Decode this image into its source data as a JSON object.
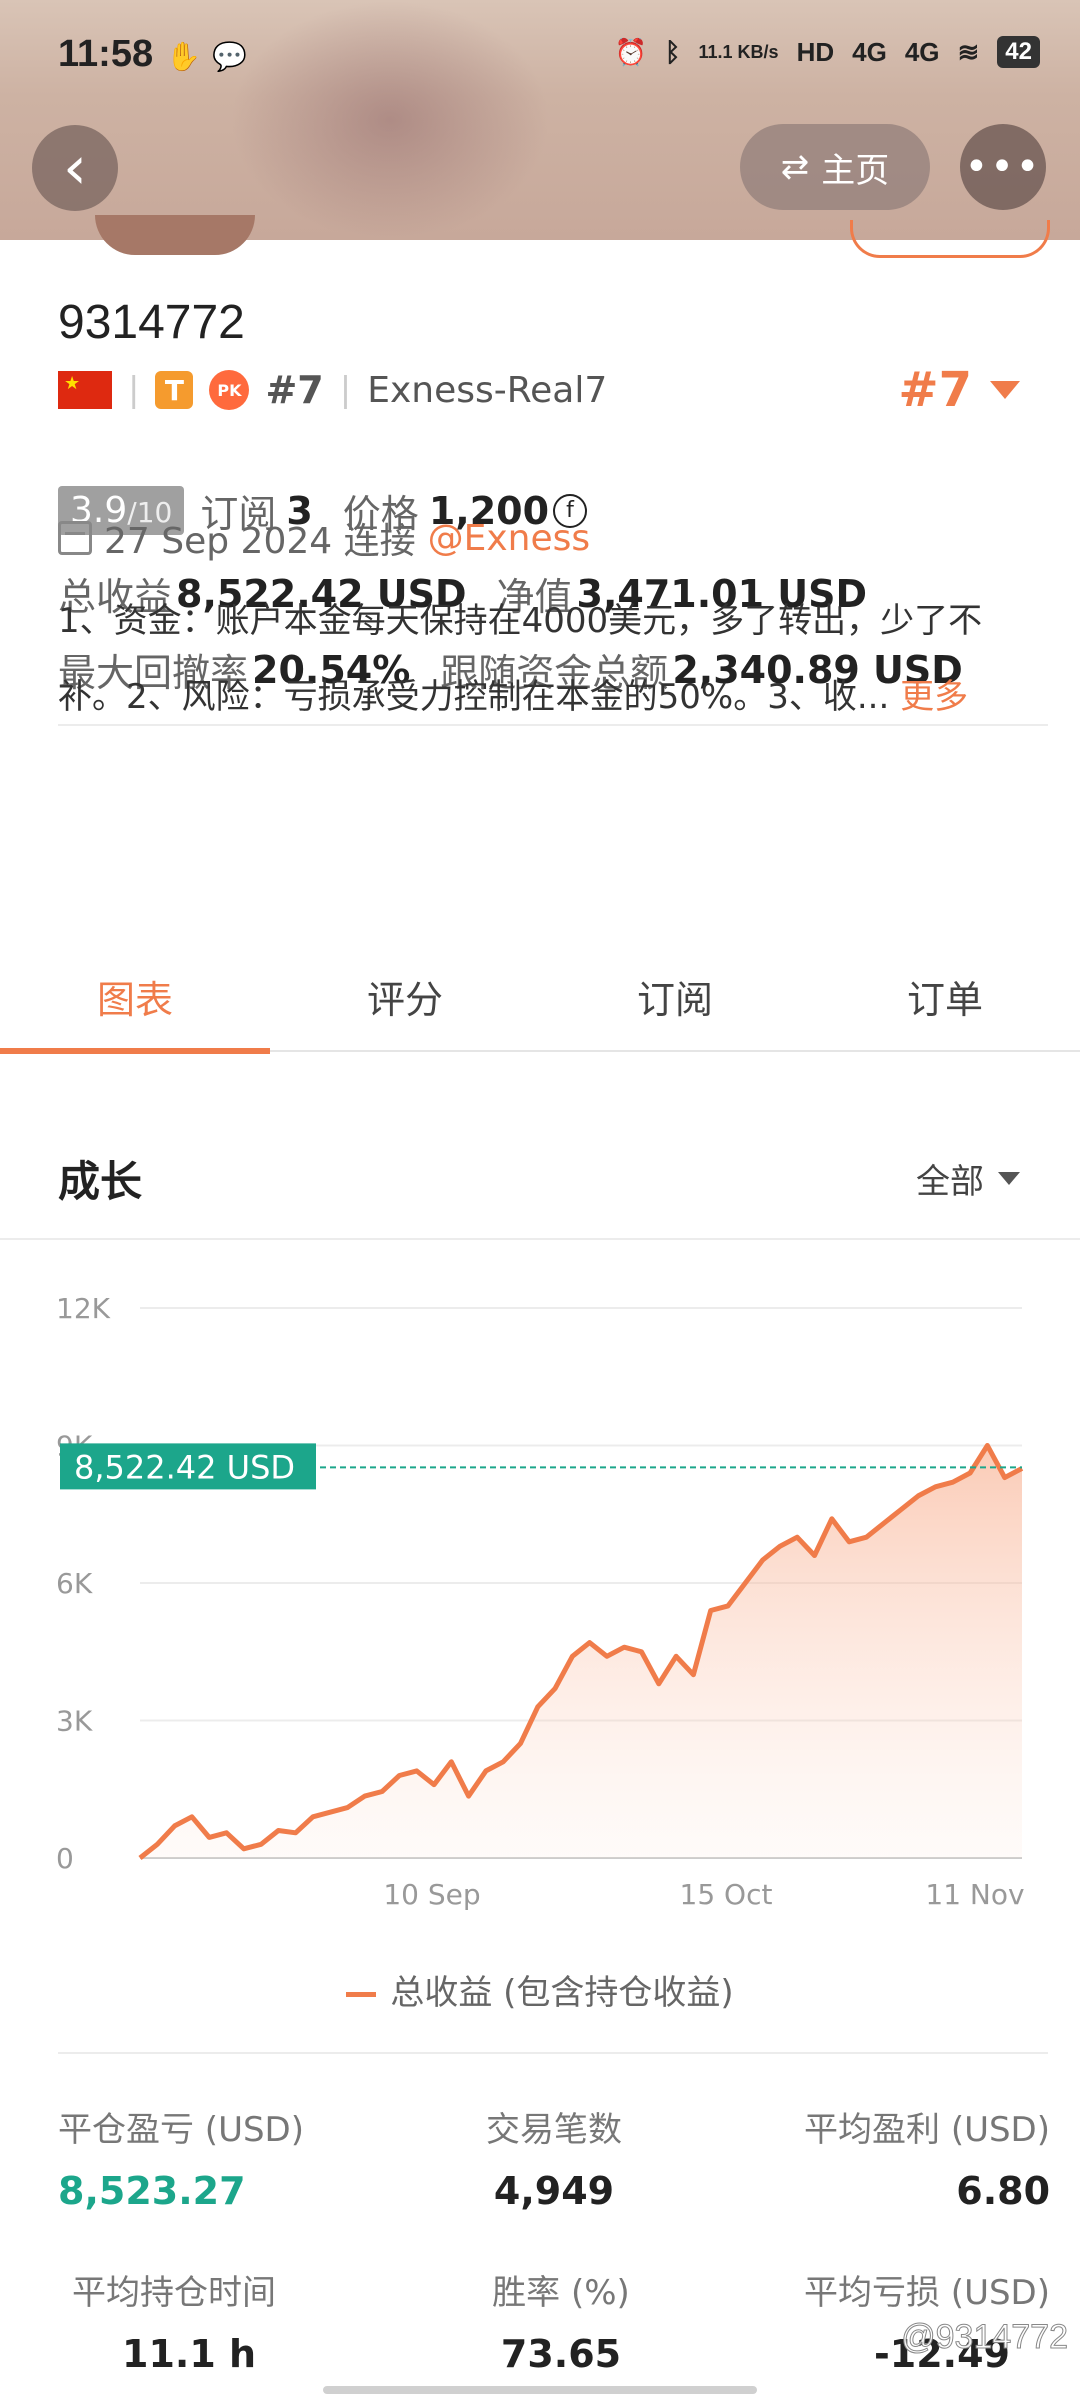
{
  "status_bar": {
    "time": "11:58",
    "network_speed": "11.1\nKB/s",
    "signal_1": "4G",
    "signal_2": "4G",
    "battery": "42"
  },
  "nav": {
    "home_label": "主页",
    "back_icon": "back-arrow-icon",
    "more_icon": "more-dots-icon"
  },
  "profile": {
    "account_id": "9314772",
    "rank_small": "#7",
    "server": "Exness-Real7",
    "rank_big": "#7",
    "t_badge": "T",
    "pk_badge": "PK"
  },
  "stats": {
    "score": "3.9",
    "score_max": "/10",
    "subscribe_label": "订阅",
    "subscribe_count": "3",
    "price_label": "价格",
    "price_value": "1,200",
    "price_symbol": "f",
    "total_profit_label": "总收益",
    "total_profit_value": "8,522.42 USD",
    "equity_label": "净值",
    "equity_value": "3,471.01 USD",
    "max_dd_label": "最大回撤率",
    "max_dd_value": "20.54%",
    "follow_funds_label": "跟随资金总额",
    "follow_funds_value": "2,340.89 USD"
  },
  "connection": {
    "date": "27 Sep 2024 连接",
    "broker": "@Exness"
  },
  "description": {
    "text": "1、资金：账户本金每天保持在4000美元，多了转出，少了不补。2、风险：亏损承受力控制在本金的50%。3、收...",
    "more": "更多"
  },
  "tabs": [
    {
      "label": "图表",
      "active": true
    },
    {
      "label": "评分",
      "active": false
    },
    {
      "label": "订阅",
      "active": false
    },
    {
      "label": "订单",
      "active": false
    }
  ],
  "section": {
    "title": "成长",
    "range": "全部"
  },
  "chart_data": {
    "type": "area",
    "y_ticks": [
      "12K",
      "9K",
      "6K",
      "3K",
      "0"
    ],
    "ylim": [
      0,
      12000
    ],
    "x_tick_labels": [
      "10 Sep",
      "15 Oct",
      "11 Nov"
    ],
    "current_label": "8,522.42 USD",
    "current_value": 8522.42,
    "legend": "总收益 (包含持仓收益)",
    "series": [
      {
        "name": "总收益 (包含持仓收益)",
        "values": [
          0,
          300,
          700,
          900,
          450,
          550,
          200,
          300,
          600,
          550,
          900,
          1000,
          1100,
          1350,
          1450,
          1800,
          1900,
          1600,
          2100,
          1350,
          1900,
          2100,
          2500,
          3300,
          3700,
          4400,
          4700,
          4400,
          4600,
          4500,
          3800,
          4400,
          4000,
          5400,
          5500,
          6000,
          6500,
          6800,
          7000,
          6600,
          7400,
          6900,
          7000,
          7300,
          7600,
          7900,
          8100,
          8200,
          8400,
          9000,
          8300,
          8500
        ]
      }
    ]
  },
  "summary": [
    {
      "label": "平仓盈亏 (USD)",
      "value": "8,523.27",
      "green": true
    },
    {
      "label": "交易笔数",
      "value": "4,949",
      "green": false
    },
    {
      "label": "平均盈利 (USD)",
      "value": "6.80",
      "green": false
    },
    {
      "label": "平均持仓时间",
      "value": "11.1 h",
      "green": false
    },
    {
      "label": "胜率 (%)",
      "value": "73.65",
      "green": false
    },
    {
      "label": "平均亏损 (USD)",
      "value": "-12.49",
      "green": false
    }
  ],
  "watermark": "@9314772"
}
